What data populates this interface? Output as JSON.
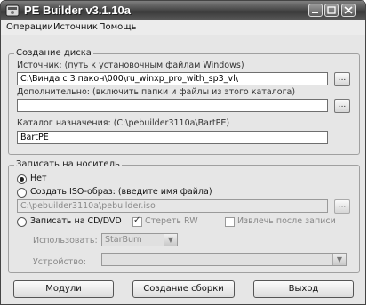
{
  "window": {
    "title": "PE Builder v3.1.10a"
  },
  "menu": [
    "Операции",
    "Источник",
    "Помощь"
  ],
  "create_disk": {
    "legend": "Создание диска",
    "source_label": "Источник: (путь к установочным файлам Windows)",
    "source_value": "C:\\Винда с 3 пакон\\000\\ru_winxp_pro_with_sp3_vl\\",
    "additional_label": "Дополнительно: (включить папки и файлы из этого каталога)",
    "additional_value": "",
    "output_label": "Каталог назначения: (C:\\pebuilder3110a\\BartPE)",
    "output_value": "BartPE",
    "browse_label": "..."
  },
  "media": {
    "legend": "Записать на носитель",
    "opt_none": "Нет",
    "opt_iso": "Создать ISO-образ: (введите имя файла)",
    "iso_value": "C:\\pebuilder3110a\\pebuilder.iso",
    "opt_cd": "Записать на CD/DVD",
    "erase_rw": "Стереть RW",
    "eject_after": "Извлечь после записи",
    "use_label": "Использовать:",
    "use_value": "StarBurn",
    "device_label": "Устройство:",
    "device_value": "",
    "selected": "none"
  },
  "buttons": {
    "modules": "Модули",
    "build": "Создание сборки",
    "exit": "Выход"
  }
}
